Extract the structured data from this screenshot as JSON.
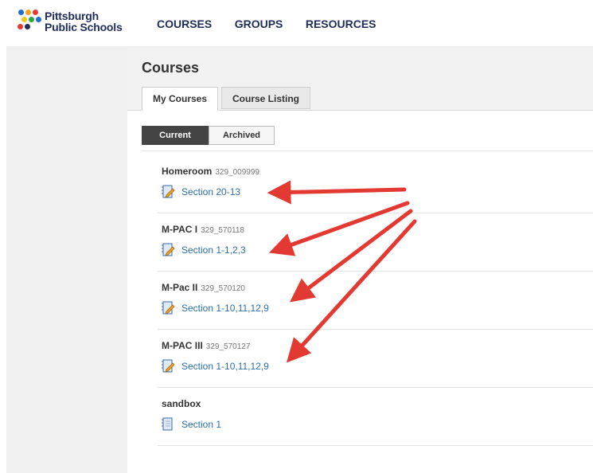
{
  "header": {
    "logo_line1": "Pittsburgh",
    "logo_line2": "Public Schools",
    "nav": [
      "COURSES",
      "GROUPS",
      "RESOURCES"
    ]
  },
  "page": {
    "title": "Courses",
    "tabs": [
      {
        "label": "My Courses",
        "active": true
      },
      {
        "label": "Course Listing",
        "active": false
      }
    ],
    "filters": [
      {
        "label": "Current",
        "selected": true
      },
      {
        "label": "Archived",
        "selected": false
      }
    ]
  },
  "courses": [
    {
      "name": "Homeroom",
      "code": "329_009999",
      "section": "Section 20-13",
      "icon": "edit-notebook-icon"
    },
    {
      "name": "M-PAC I",
      "code": "329_570118",
      "section": "Section 1-1,2,3",
      "icon": "edit-notebook-icon"
    },
    {
      "name": "M-Pac II",
      "code": "329_570120",
      "section": "Section 1-10,11,12,9",
      "icon": "edit-notebook-icon"
    },
    {
      "name": "M-PAC III",
      "code": "329_570127",
      "section": "Section 1-10,11,12,9",
      "icon": "edit-notebook-icon"
    },
    {
      "name": "sandbox",
      "code": "",
      "section": "Section 1",
      "icon": "notebook-icon"
    }
  ],
  "colors": {
    "nav_text": "#1f2d5a",
    "link": "#2b6ea9",
    "annotation_arrow": "#e23a33",
    "active_filter": "#444444"
  }
}
